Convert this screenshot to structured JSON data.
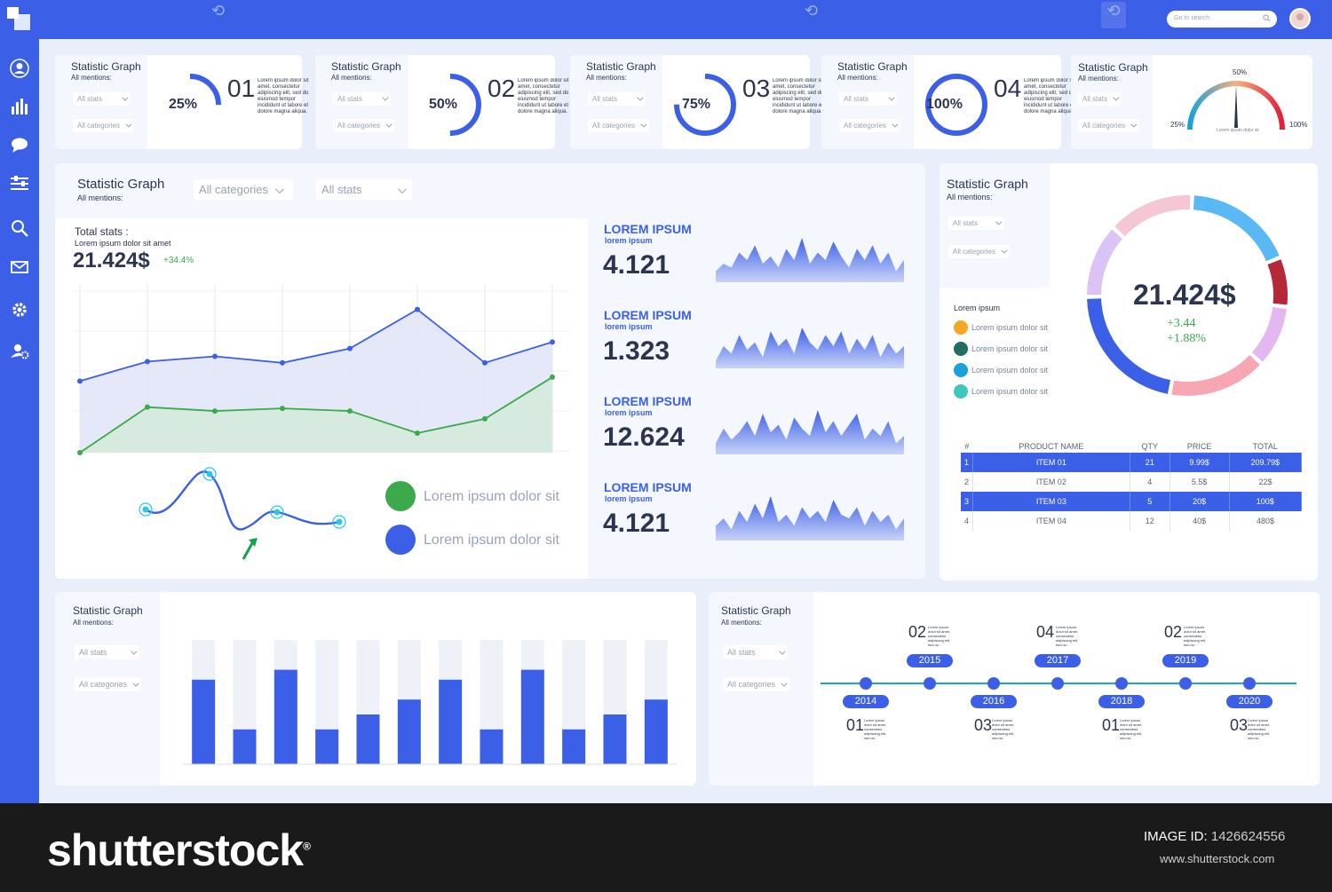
{
  "colors": {
    "primary": "#3b5fe6",
    "green": "#3aaa4a",
    "footer": "#1a1a1a"
  },
  "topbar": {
    "search_placeholder": "Go to search",
    "search_icon": "search-icon",
    "avatar": "user-avatar"
  },
  "sidebar": {
    "icons": [
      "user-icon",
      "bar-chart-icon",
      "chat-icon",
      "sliders-icon",
      "search-icon",
      "mail-icon",
      "gear-icon",
      "user-settings-icon"
    ]
  },
  "kpi_cards": [
    {
      "title": "Statistic Graph",
      "subtitle": "All mentions:",
      "dd_stats": "All stats",
      "dd_categories": "All categories",
      "percent": "25%",
      "value": 25,
      "number": "01",
      "text": "Lorem ipsum dolor sit amet, consectetur adipiscing elit, sed do eiusmod tempor incididunt ut labore et dolore magna aliqua."
    },
    {
      "title": "Statistic Graph",
      "subtitle": "All mentions:",
      "dd_stats": "All stats",
      "dd_categories": "All categories",
      "percent": "50%",
      "value": 50,
      "number": "02",
      "text": "Lorem ipsum dolor sit amet, consectetur adipiscing elit, sed do eiusmod tempor incididunt ut labore et dolore magna aliqua."
    },
    {
      "title": "Statistic Graph",
      "subtitle": "All mentions:",
      "dd_stats": "All stats",
      "dd_categories": "All categories",
      "percent": "75%",
      "value": 75,
      "number": "03",
      "text": "Lorem ipsum dolor sit amet, consectetur adipiscing elit, sed do eiusmod tempor incididunt ut labore et dolore magna aliqua."
    },
    {
      "title": "Statistic Graph",
      "subtitle": "All mentions:",
      "dd_stats": "All stats",
      "dd_categories": "All categories",
      "percent": "100%",
      "value": 100,
      "number": "04",
      "text": "Lorem ipsum dolor sit amet, consectetur adipiscing elit, sed do eiusmod tempor incididunt ut labore et dolore magna aliqua."
    }
  ],
  "gauge_card": {
    "title": "Statistic Graph",
    "subtitle": "All mentions:",
    "dd_stats": "All stats",
    "dd_categories": "All categories",
    "label_min": "25%",
    "label_mid": "50%",
    "label_max": "100%",
    "caption": "Lorem ipsum dolor sit",
    "needle_value": 50
  },
  "main_panel": {
    "title": "Statistic Graph",
    "subtitle": "All mentions:",
    "dd_categories": "All categories",
    "dd_stats": "All stats",
    "total_label": "Total stats :",
    "total_sub": "Lorem ipsum dolor sit amet",
    "total_value": "21.424$",
    "total_change": "+34.4%",
    "legend": [
      {
        "label": "Lorem ipsum dolor sit",
        "color": "#3aaa4a"
      },
      {
        "label": "Lorem ipsum dolor sit",
        "color": "#3b5fe6"
      }
    ]
  },
  "chart_data": [
    {
      "type": "area",
      "series": [
        {
          "color": "#3b5fe6",
          "values": [
            5.5,
            7.0,
            7.4,
            6.9,
            8.0,
            11.0,
            6.9,
            8.5
          ]
        },
        {
          "color": "#3aaa4a",
          "values": [
            0.0,
            3.5,
            3.2,
            3.4,
            3.2,
            1.5,
            2.6,
            5.8
          ]
        }
      ],
      "ylim": [
        0,
        12
      ]
    },
    {
      "type": "line",
      "series": [
        {
          "color": "#3b5fe6",
          "values": [
            0,
            1,
            -1,
            0,
            0
          ]
        }
      ]
    },
    {
      "type": "bar",
      "values": [
        68,
        28,
        76,
        28,
        40,
        52,
        68,
        28,
        76,
        28,
        40,
        52
      ],
      "background_values": [
        100,
        100,
        100,
        100,
        100,
        100,
        100,
        100,
        100,
        100,
        100,
        100
      ],
      "ylim": [
        0,
        100
      ]
    }
  ],
  "sparklines": [
    {
      "title": "LOREM IPSUM",
      "subtitle": "lorem ipsum",
      "value": "4.121",
      "points": [
        3,
        5,
        4,
        8,
        6,
        10,
        5,
        7,
        4,
        9,
        6,
        12,
        5,
        8,
        6,
        11,
        7,
        4,
        9,
        6,
        10,
        5,
        8,
        3,
        6
      ]
    },
    {
      "title": "LOREM IPSUM",
      "subtitle": "lorem ipsum",
      "value": "1.323",
      "points": [
        2,
        6,
        4,
        9,
        5,
        7,
        3,
        10,
        6,
        8,
        4,
        11,
        7,
        5,
        9,
        6,
        10,
        4,
        8,
        5,
        9,
        3,
        7,
        4,
        6
      ]
    },
    {
      "title": "LOREM IPSUM",
      "subtitle": "lorem ipsum",
      "value": "12.624",
      "points": [
        3,
        7,
        4,
        6,
        9,
        5,
        11,
        6,
        8,
        4,
        10,
        7,
        5,
        12,
        6,
        9,
        5,
        8,
        11,
        4,
        7,
        5,
        9,
        3,
        5
      ]
    },
    {
      "title": "LOREM IPSUM",
      "subtitle": "lorem ipsum",
      "value": "4.121",
      "points": [
        4,
        6,
        3,
        8,
        5,
        10,
        6,
        12,
        5,
        7,
        4,
        9,
        6,
        8,
        5,
        11,
        7,
        6,
        9,
        4,
        8,
        5,
        7,
        3,
        6
      ]
    }
  ],
  "ring_panel": {
    "title": "Statistic Graph",
    "subtitle": "All mentions:",
    "dd_stats": "All stats",
    "dd_categories": "All categories",
    "legend_title": "Lorem ipsum",
    "legend": [
      {
        "label": "Lorem ipsum  dolor sit",
        "color": "#f5a623"
      },
      {
        "label": "Lorem ipsum  dolor sit",
        "color": "#1f6e5e"
      },
      {
        "label": "Lorem ipsum  dolor sit",
        "color": "#1aa0dc"
      },
      {
        "label": "Lorem ipsum  dolor sit",
        "color": "#3ec6c0"
      }
    ],
    "center_value": "21.424$",
    "center_change1": "+3.44",
    "center_change2": "+1.88%",
    "ring_segments": [
      {
        "color": "#5ab8f5",
        "value": 18
      },
      {
        "color": "#b5283a",
        "value": 8
      },
      {
        "color": "#e3b8f0",
        "value": 10
      },
      {
        "color": "#f7a6b4",
        "value": 16
      },
      {
        "color": "#3b5fe6",
        "value": 22
      },
      {
        "color": "#dcc3f5",
        "value": 12
      },
      {
        "color": "#f5c6d3",
        "value": 14
      }
    ],
    "table": {
      "headers": [
        "#",
        "PRODUCT NAME",
        "QTY",
        "PRICE",
        "TOTAL"
      ],
      "rows": [
        {
          "cells": [
            "1",
            "ITEM 01",
            "21",
            "9.99$",
            "209.79$"
          ],
          "highlight": true
        },
        {
          "cells": [
            "2",
            "ITEM 02",
            "4",
            "5.5$",
            "22$"
          ],
          "highlight": false
        },
        {
          "cells": [
            "3",
            "ITEM 03",
            "5",
            "20$",
            "100$"
          ],
          "highlight": true
        },
        {
          "cells": [
            "4",
            "ITEM 04",
            "12",
            "40$",
            "480$"
          ],
          "highlight": false
        }
      ]
    }
  },
  "bar_panel": {
    "title": "Statistic Graph",
    "subtitle": "All mentions:",
    "dd_stats": "All stats",
    "dd_categories": "All categories"
  },
  "timeline_panel": {
    "title": "Statistic Graph",
    "subtitle": "All mentions:",
    "dd_stats": "All stats",
    "dd_categories": "All categories",
    "years_top": [
      {
        "year": "2015",
        "number": "02"
      },
      {
        "year": "2017",
        "number": "04"
      },
      {
        "year": "2019",
        "number": "02"
      }
    ],
    "years_bottom": [
      {
        "year": "2014",
        "number": "01"
      },
      {
        "year": "2016",
        "number": "03"
      },
      {
        "year": "2018",
        "number": "01"
      },
      {
        "year": "2020",
        "number": "03"
      }
    ],
    "note": "Lorem ipsum dolor sit amet, consectetur adipiscing elit, sed do."
  },
  "footer": {
    "brand": "shutterstock",
    "image_id_label": "IMAGE ID:",
    "image_id_value": "1426624556",
    "site": "www.shutterstock.com"
  }
}
